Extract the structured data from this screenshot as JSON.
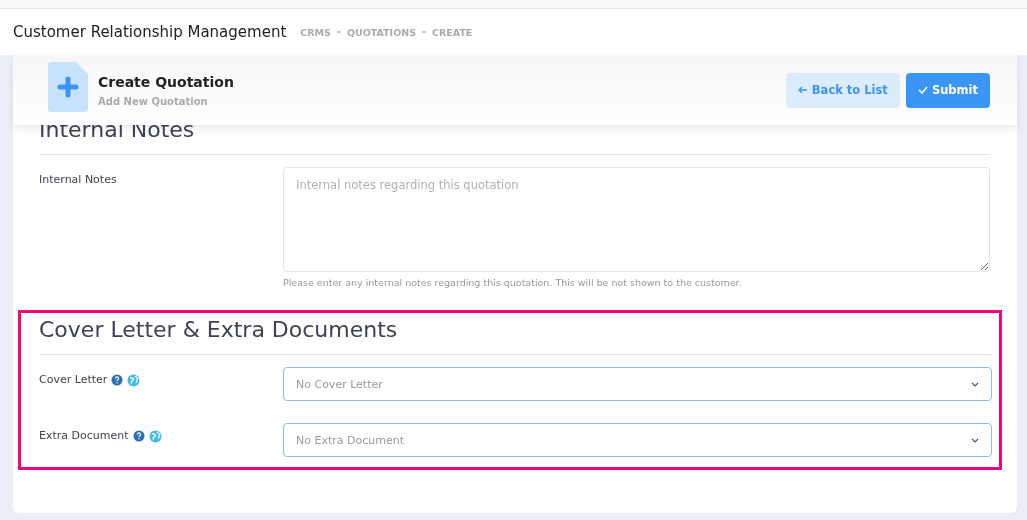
{
  "header": {
    "title": "Customer Relationship Management",
    "breadcrumbs": [
      "CRMS",
      "QUOTATIONS",
      "CREATE"
    ]
  },
  "toolbar": {
    "title": "Create Quotation",
    "subtitle": "Add New Quotation",
    "buttons": [
      {
        "label": "Back to List",
        "kind": "back"
      },
      {
        "label": "Submit",
        "kind": "submit"
      }
    ]
  },
  "sections": [
    {
      "title": "Internal Notes",
      "highlighted": false,
      "fields": [
        {
          "kind": "textarea",
          "label": "Internal Notes",
          "placeholder": "Internal notes regarding this quotation",
          "help": "Please enter any internal notes regarding this quotation. This will be not shown to the customer."
        }
      ]
    },
    {
      "title": "Cover Letter & Extra Documents",
      "highlighted": true,
      "fields": [
        {
          "kind": "select",
          "label": "Cover Letter",
          "value": "No Cover Letter"
        },
        {
          "kind": "select",
          "label": "Extra Document",
          "value": "No Extra Document"
        }
      ]
    }
  ]
}
